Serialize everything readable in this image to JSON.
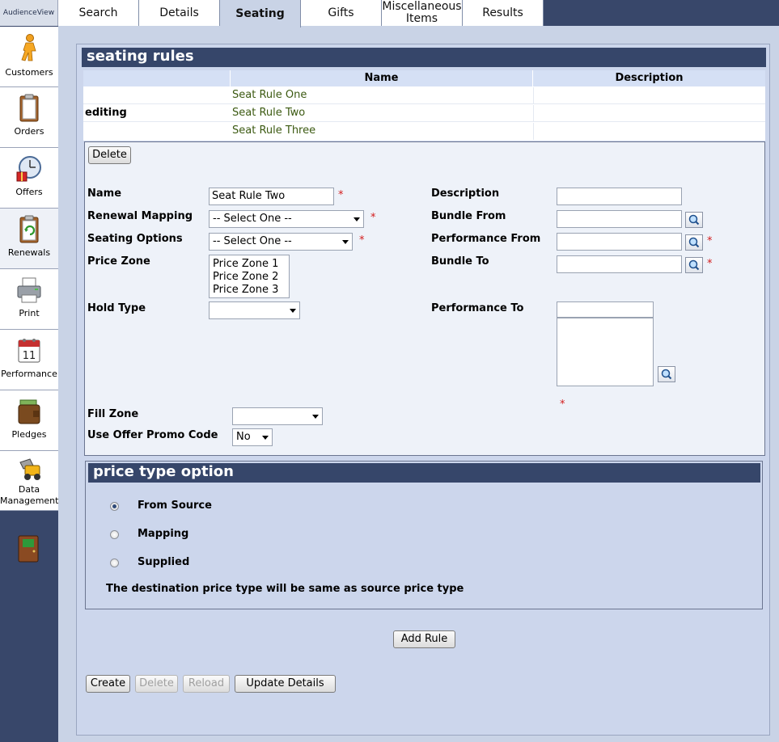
{
  "app": {
    "brand": "AudienceView"
  },
  "nav": [
    {
      "label": "Customers",
      "icon": "customers-icon"
    },
    {
      "label": "Orders",
      "icon": "orders-icon"
    },
    {
      "label": "Offers",
      "icon": "offers-icon"
    },
    {
      "label": "Renewals",
      "icon": "renewals-icon"
    },
    {
      "label": "Print",
      "icon": "printer-icon"
    },
    {
      "label": "Performance",
      "icon": "calendar-icon"
    },
    {
      "label": "Pledges",
      "icon": "wallet-icon"
    },
    {
      "label": "Data Management",
      "icon": "loader-icon"
    }
  ],
  "tabs": [
    "Search",
    "Details",
    "Seating",
    "Gifts",
    "Miscellaneous Items",
    "Results"
  ],
  "active_tab": "Seating",
  "seating_rules": {
    "title": "seating rules",
    "columns": [
      "Name",
      "Description"
    ],
    "rows": [
      {
        "status": "",
        "name": "Seat Rule One",
        "description": ""
      },
      {
        "status": "editing",
        "name": "Seat Rule Two",
        "description": ""
      },
      {
        "status": "",
        "name": "Seat Rule Three",
        "description": ""
      }
    ]
  },
  "form": {
    "delete_label": "Delete",
    "required_mark": "*",
    "name": {
      "label": "Name",
      "value": "Seat Rule Two"
    },
    "renewal_mapping": {
      "label": "Renewal Mapping",
      "value": "-- Select One --"
    },
    "seating_options": {
      "label": "Seating Options",
      "value": "-- Select One --"
    },
    "price_zone": {
      "label": "Price Zone",
      "options": [
        "Price Zone 1",
        "Price Zone 2",
        "Price Zone 3"
      ]
    },
    "hold_type": {
      "label": "Hold Type",
      "value": ""
    },
    "fill_zone": {
      "label": "Fill Zone",
      "value": ""
    },
    "use_offer_promo_code": {
      "label": "Use Offer Promo Code",
      "value": "No"
    },
    "description": {
      "label": "Description",
      "value": ""
    },
    "bundle_from": {
      "label": "Bundle From",
      "value": ""
    },
    "performance_from": {
      "label": "Performance From",
      "value": ""
    },
    "bundle_to": {
      "label": "Bundle To",
      "value": ""
    },
    "performance_to": {
      "label": "Performance To",
      "value": ""
    }
  },
  "price_type_option": {
    "title": "price type option",
    "options": [
      "From Source",
      "Mapping",
      "Supplied"
    ],
    "selected": "From Source",
    "note": "The destination price type will be same as source price type"
  },
  "buttons": {
    "add_rule": "Add Rule",
    "create": "Create",
    "delete": "Delete",
    "reload": "Reload",
    "update_details": "Update Details"
  }
}
